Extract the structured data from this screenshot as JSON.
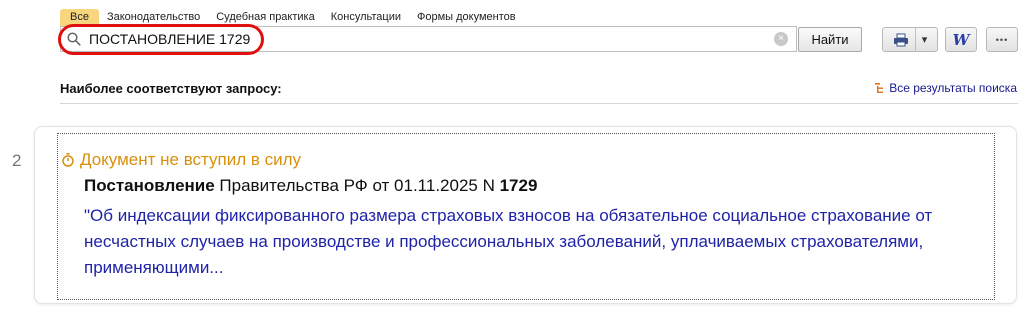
{
  "tabs": [
    {
      "label": "Все",
      "active": true
    },
    {
      "label": "Законодательство",
      "active": false
    },
    {
      "label": "Судебная практика",
      "active": false
    },
    {
      "label": "Консультации",
      "active": false
    },
    {
      "label": "Формы документов",
      "active": false
    }
  ],
  "search": {
    "value": "ПОСТАНОВЛЕНИЕ 1729",
    "icon": "search-icon",
    "clear_icon": "×",
    "button_label": "Найти"
  },
  "toolbar": {
    "print_icon": "printer-icon",
    "dropdown_icon": "▾",
    "word_icon_label": "W",
    "more_label": "•••"
  },
  "results": {
    "heading": "Наиболее соответствуют запросу:",
    "all_results_label": "Все результаты поиска",
    "items": [
      {
        "number": "2",
        "status": "Документ не вступил в силу",
        "doc_type": "Постановление",
        "doc_info": " Правительства РФ от 01.11.2025 N ",
        "doc_number": "1729",
        "title": "\"Об индексации фиксированного размера страховых взносов на обязательное социальное страхование от несчастных случаев на производстве и профессиональных заболеваний, уплачиваемых страхователями, применяющими..."
      }
    ]
  },
  "colors": {
    "active_tab": "#f7d67d",
    "highlight_ring": "#e01010",
    "status_text": "#d8900c",
    "link_text": "#1f23a8"
  }
}
